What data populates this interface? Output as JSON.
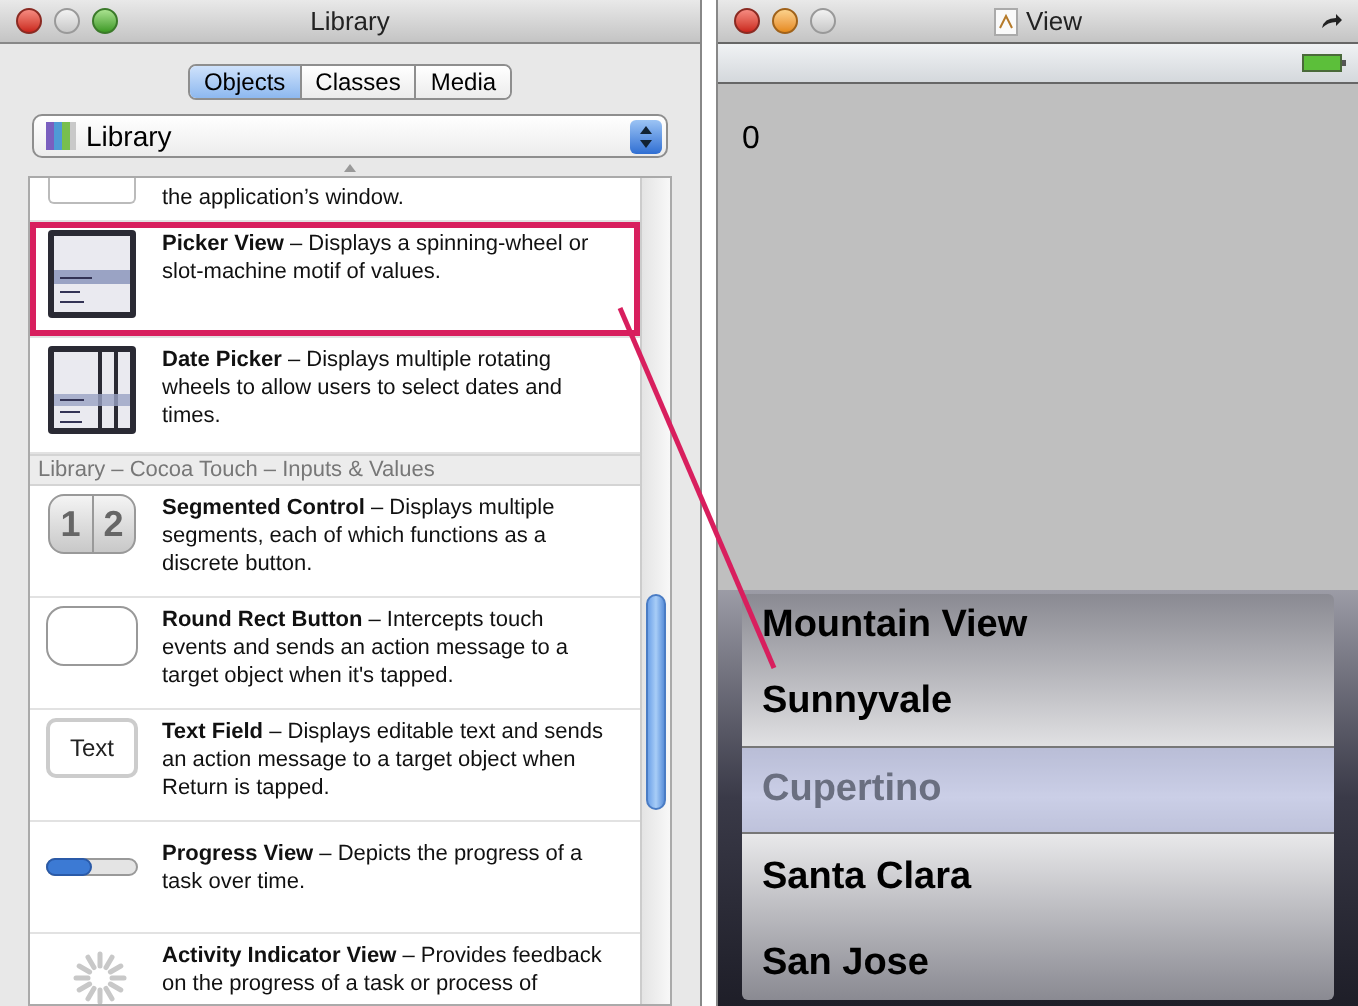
{
  "library_window": {
    "title": "Library",
    "tabs": [
      {
        "label": "Objects",
        "selected": true
      },
      {
        "label": "Classes",
        "selected": false
      },
      {
        "label": "Media",
        "selected": false
      }
    ],
    "popup": {
      "value": "Library"
    },
    "items": [
      {
        "kind": "blank",
        "text": "the application’s window.",
        "highlighted": false
      },
      {
        "kind": "picker",
        "text": "**Picker View** – Displays a spinning-wheel or slot-machine motif of values.",
        "highlighted": true
      },
      {
        "kind": "date-picker",
        "text": "**Date Picker** – Displays multiple rotating wheels to allow users to select dates and times.",
        "highlighted": false
      },
      {
        "kind": "header",
        "text": "Library – Cocoa Touch – Inputs & Values",
        "highlighted": false
      },
      {
        "kind": "segmented",
        "text": "**Segmented Control** – Displays multiple segments, each of which functions as a discrete button.",
        "icon_labels": [
          "1",
          "2"
        ],
        "highlighted": false
      },
      {
        "kind": "round-rect",
        "text": "**Round Rect Button** – Intercepts touch events and sends an action message to a target object when it's tapped.",
        "highlighted": false
      },
      {
        "kind": "text-field",
        "text": "**Text Field** – Displays editable text and sends an action message to a target object when Return is tapped.",
        "icon_label": "Text",
        "highlighted": false
      },
      {
        "kind": "progress",
        "text": "**Progress View** – Depicts the progress of a task over time.",
        "highlighted": false
      },
      {
        "kind": "activity",
        "text": "**Activity Indicator View** – Provides feedback on the progress of a task or process of",
        "highlighted": false
      }
    ]
  },
  "view_window": {
    "title": "View",
    "label": "0",
    "picker_rows": [
      {
        "label": "Mountain View",
        "selected": false
      },
      {
        "label": "Sunnyvale",
        "selected": false
      },
      {
        "label": "Cupertino",
        "selected": true
      },
      {
        "label": "Santa Clara",
        "selected": false
      },
      {
        "label": "San Jose",
        "selected": false
      }
    ]
  }
}
